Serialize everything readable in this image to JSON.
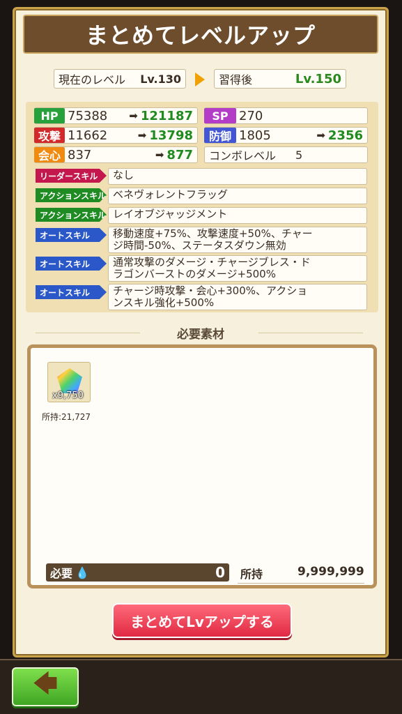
{
  "title": "まとめてレベルアップ",
  "level": {
    "current_label": "現在のレベル",
    "current_value": "Lv.130",
    "after_label": "習得後",
    "after_value": "Lv.150"
  },
  "stats": {
    "hp": {
      "tag": "HP",
      "from": "75388",
      "arrow": "➡",
      "to": "121187"
    },
    "sp": {
      "tag": "SP",
      "value": "270"
    },
    "atk": {
      "tag": "攻撃",
      "from": "11662",
      "arrow": "➡",
      "to": "13798"
    },
    "def": {
      "tag": "防御",
      "from": "1805",
      "arrow": "➡",
      "to": "2356"
    },
    "crit": {
      "tag": "会心",
      "from": "837",
      "arrow": "➡",
      "to": "877"
    },
    "combo": {
      "label": "コンボレベル",
      "value": "5"
    }
  },
  "skills": [
    {
      "type": "リーダースキル",
      "text": "なし"
    },
    {
      "type": "アクションスキル",
      "text": "ベネヴォレントフラッグ"
    },
    {
      "type": "アクションスキル",
      "text": "レイオブジャッジメント"
    },
    {
      "type": "オートスキル",
      "line1": "移動速度+75%、攻撃速度+50%、チャー",
      "line2": "ジ時間-50%、ステータスダウン無効"
    },
    {
      "type": "オートスキル",
      "line1": "通常攻撃のダメージ・チャージブレス・ド",
      "line2": "ラゴンバーストのダメージ+500%"
    },
    {
      "type": "オートスキル",
      "line1": "チャージ時攻撃・会心+300%、アクショ",
      "line2": "ンスキル強化+500%"
    }
  ],
  "materials": {
    "header": "必要素材",
    "item": {
      "qty": "x9,750",
      "owned": "所持:21,727"
    },
    "need_label": "必要",
    "need_value": "0",
    "own_label": "所持",
    "own_value": "9,999,999"
  },
  "bulk_button": "まとめてLvアップする",
  "back_arrow": "🡄"
}
